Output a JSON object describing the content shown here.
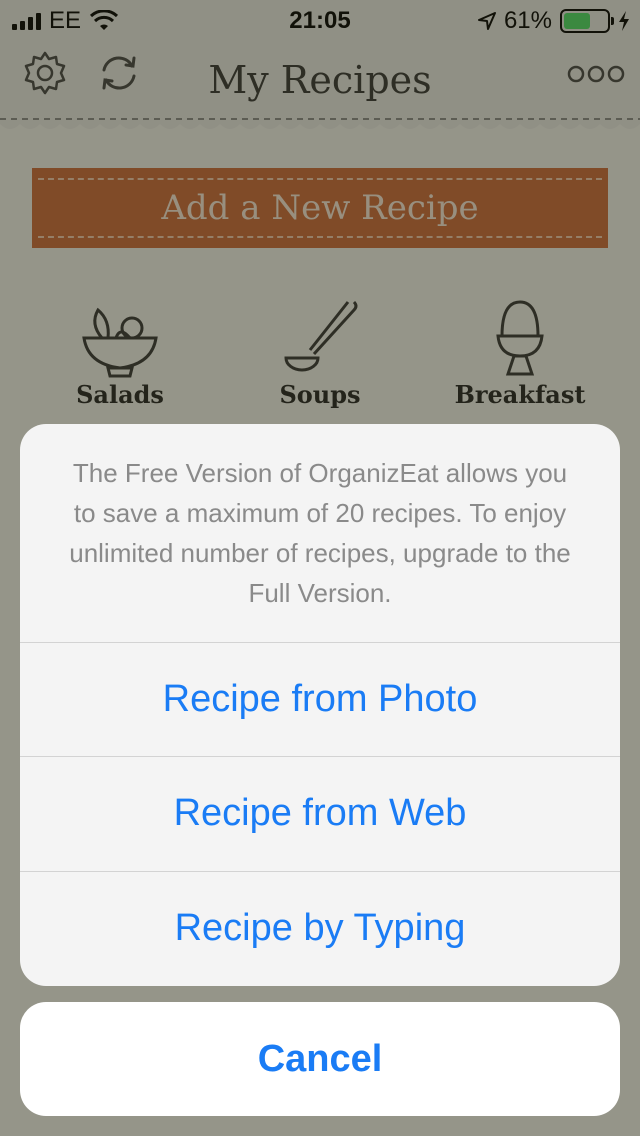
{
  "status_bar": {
    "carrier": "EE",
    "time": "21:05",
    "battery": "61%",
    "battery_level": 0.61
  },
  "navbar": {
    "title": "My Recipes",
    "left_icons": [
      "gear-icon",
      "sync-icon"
    ],
    "right_icon": "more-icon"
  },
  "add_button": {
    "label": "Add a New Recipe"
  },
  "categories": [
    {
      "label": "Salads",
      "icon": "salad-bowl-icon"
    },
    {
      "label": "Soups",
      "icon": "ladle-icon"
    },
    {
      "label": "Breakfast",
      "icon": "egg-cup-icon"
    }
  ],
  "action_sheet": {
    "message": "The Free Version of OrganizEat allows you to save a maximum of 20 recipes. To enjoy unlimited number of recipes, upgrade to the Full Version.",
    "actions": [
      {
        "label": "Recipe from Photo"
      },
      {
        "label": "Recipe from Web"
      },
      {
        "label": "Recipe by Typing"
      }
    ],
    "cancel_label": "Cancel"
  },
  "colors": {
    "accent_blue": "#1a7cf5",
    "add_button": "#c8693a",
    "battery_green": "#4cd964"
  }
}
